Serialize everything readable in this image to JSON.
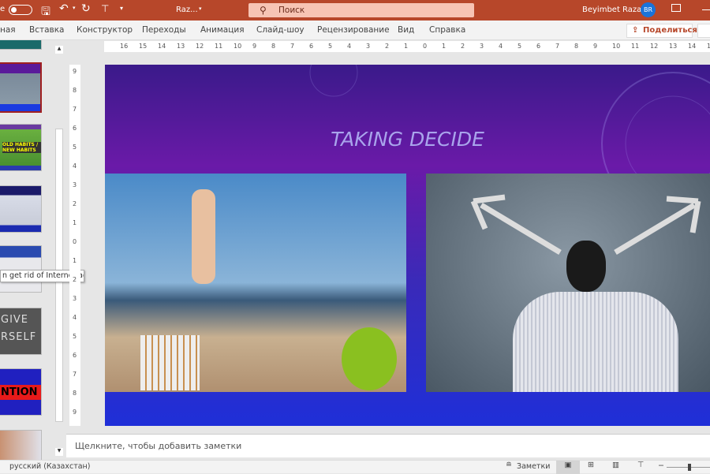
{
  "titlebar": {
    "autosave_partial": "e",
    "doc_name": "Raz...",
    "search_placeholder": "Поиск",
    "user_name": "Beyimbet Razak",
    "user_initials": "BR",
    "color": "#b7472a"
  },
  "ribbon": {
    "tabs": [
      "ная",
      "Вставка",
      "Конструктор",
      "Переходы",
      "Анимация",
      "Слайд-шоу",
      "Рецензирование",
      "Вид",
      "Справка"
    ],
    "share_label": "Поделиться"
  },
  "thumbnails": [
    {
      "text": ""
    },
    {
      "text": ""
    },
    {
      "text": "OLD HABITS / NEW HABITS"
    },
    {
      "text": ""
    },
    {
      "text": ""
    },
    {
      "text": "GIVE RSELF"
    },
    {
      "text": "NTION"
    },
    {
      "text": ""
    }
  ],
  "tooltip": "n get rid of Internet addi...",
  "hruler": [
    "16",
    "15",
    "14",
    "13",
    "12",
    "11",
    "10",
    "9",
    "8",
    "7",
    "6",
    "5",
    "4",
    "3",
    "2",
    "1",
    "0",
    "1",
    "2",
    "3",
    "4",
    "5",
    "6",
    "7",
    "8",
    "9",
    "10",
    "11",
    "12",
    "13",
    "14",
    "15",
    "16"
  ],
  "vruler": [
    "9",
    "8",
    "7",
    "6",
    "5",
    "4",
    "3",
    "2",
    "1",
    "0",
    "1",
    "2",
    "3",
    "4",
    "5",
    "6",
    "7",
    "8",
    "9"
  ],
  "slide": {
    "title": "TAKING DECIDE"
  },
  "notes_placeholder": "Щелкните, чтобы добавить заметки",
  "status": {
    "language": "русский (Казахстан)",
    "notes_label": "Заметки"
  }
}
